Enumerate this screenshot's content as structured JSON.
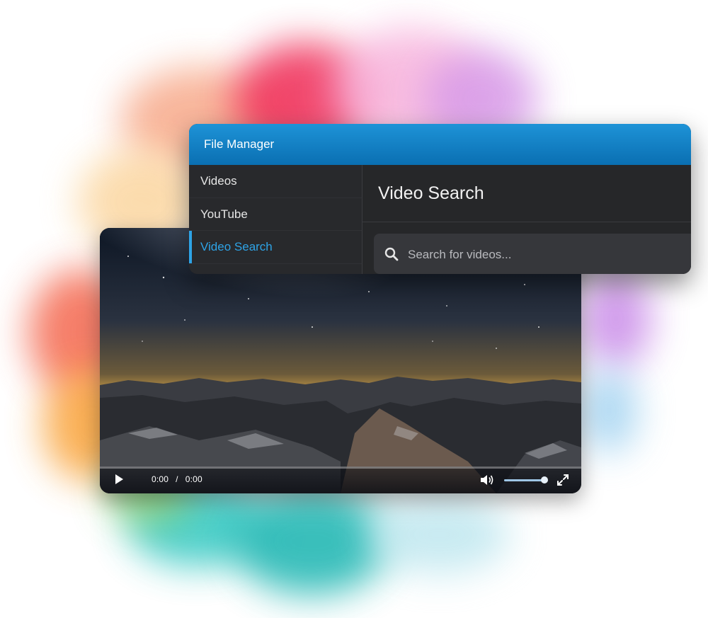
{
  "window": {
    "title": "File Manager"
  },
  "sidebar": {
    "items": [
      {
        "label": "Videos",
        "active": false
      },
      {
        "label": "YouTube",
        "active": false
      },
      {
        "label": "Video Search",
        "active": true
      }
    ]
  },
  "main": {
    "title": "Video Search",
    "search": {
      "placeholder": "Search for videos...",
      "value": "",
      "icon": "search-icon"
    }
  },
  "player": {
    "current_time": "0:00",
    "separator": "/",
    "duration": "0:00",
    "progress": 0,
    "volume": 0.92,
    "icons": [
      "play-icon",
      "volume-icon",
      "fullscreen-icon"
    ]
  },
  "colors": {
    "accent": "#2ea3e6",
    "titlebar": "#0a6fb2",
    "window_bg": "#232427"
  }
}
